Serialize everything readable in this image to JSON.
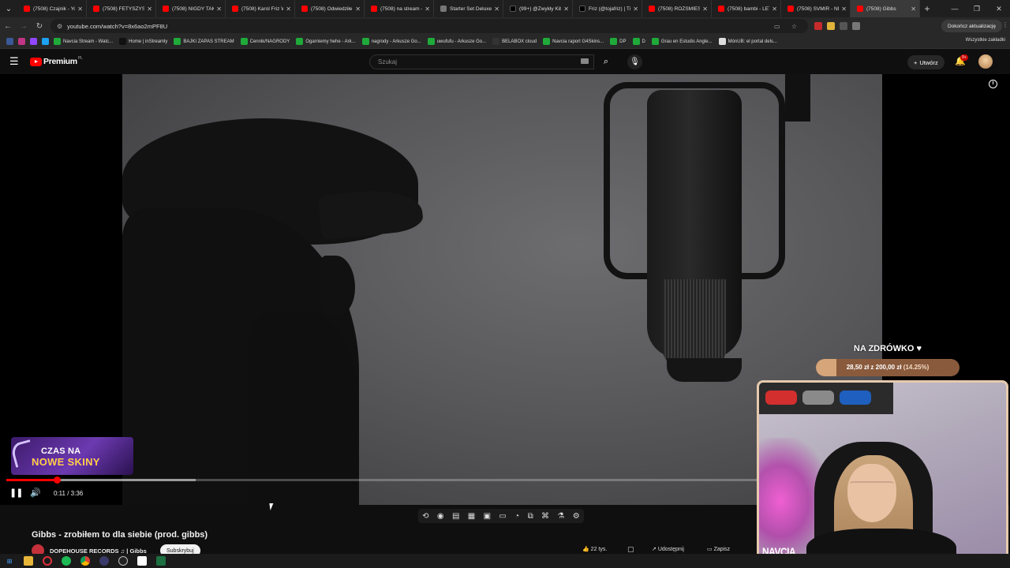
{
  "browser": {
    "tabs": [
      {
        "label": "(7508) Czajnik - Yo",
        "icon": "youtube-icon"
      },
      {
        "label": "(7508) FETYSZYSTA",
        "icon": "youtube-icon"
      },
      {
        "label": "(7508) NIGDY TAK",
        "icon": "youtube-icon"
      },
      {
        "label": "(7508) Karol Friz W",
        "icon": "youtube-icon"
      },
      {
        "label": "(7508) Odwiedziłe",
        "icon": "youtube-icon"
      },
      {
        "label": "(7508) na stream -",
        "icon": "youtube-icon"
      },
      {
        "label": "Starter Set Deluxe",
        "icon": "generic-icon"
      },
      {
        "label": "(99+) @Zwykły Kib",
        "icon": "tiktok-icon"
      },
      {
        "label": "Friz (@tojafriz) | Tik",
        "icon": "tiktok-icon"
      },
      {
        "label": "(7508) ROZŚMIESZ",
        "icon": "youtube-icon"
      },
      {
        "label": "(7508) bambi - LET",
        "icon": "youtube-icon"
      },
      {
        "label": "(7508) SVMIR - NIE",
        "icon": "youtube-icon"
      },
      {
        "label": "(7508) Gibbs",
        "icon": "youtube-icon",
        "active": true
      }
    ],
    "url": "youtube.com/watch?v=8x6ao2mPF8U",
    "update_label": "Dokończ aktualizację",
    "bookmarks": [
      {
        "label": "Navcia Stream - Watc...",
        "color": "#1faa3a"
      },
      {
        "label": "Home | inStreamly",
        "color": "#111111"
      },
      {
        "label": "BAJKI ZAPAS STREAM",
        "color": "#1faa3a"
      },
      {
        "label": "Cennik/NAGRODY",
        "color": "#1faa3a"
      },
      {
        "label": "Ogarniemy hehe - Ark...",
        "color": "#1faa3a"
      },
      {
        "label": "nagrody - Arkusze Go...",
        "color": "#1faa3a"
      },
      {
        "label": "uwufufu - Arkusze Go...",
        "color": "#1faa3a"
      },
      {
        "label": "BELABOX cloud",
        "color": "#333333"
      },
      {
        "label": "Navcia raport G4Skins...",
        "color": "#1faa3a"
      },
      {
        "label": "DP",
        "color": "#1faa3a"
      },
      {
        "label": "D",
        "color": "#1faa3a"
      },
      {
        "label": "Grau en Estudis Angle...",
        "color": "#1faa3a"
      },
      {
        "label": "MónUB: el portal dels...",
        "color": "#dddddd"
      }
    ],
    "bookmarks_all": "Wszystkie zakładki"
  },
  "youtube": {
    "brand": "Premium",
    "country": "PL",
    "search_placeholder": "Szukaj",
    "create_label": "Utwórz",
    "notifications": "9+",
    "player": {
      "current_time": "0:11",
      "duration": "3:36",
      "time_display": "0:11 / 3:36",
      "progress_fraction": 0.051,
      "buffer_fraction": 0.19
    },
    "video_title": "Gibbs - zrobiłem to dla siebie (prod. gibbs)",
    "channel_name": "DOPEHOUSE RECORDS ♫ | Gibbs",
    "subscribe_label": "Subskrybuj",
    "likes": "22 tys.",
    "share_label": "Udostępnij",
    "save_label": "Zapisz"
  },
  "overlays": {
    "banner_line1": "CZAS NA",
    "banner_line2": "NOWE SKINY",
    "goal_title": "NA ZDRÓWKO ♥",
    "goal_amount": "28,50 zł z 200,00 zł",
    "goal_percent": "(14.25%)",
    "goal_fraction": 0.1425,
    "webcam_label": "NAVCIA"
  },
  "colors": {
    "youtube_red": "#ff0000",
    "goal_bar": "#8a5a3c",
    "goal_fill": "#d6a57a",
    "webcam_border": "#e6c9ad"
  }
}
